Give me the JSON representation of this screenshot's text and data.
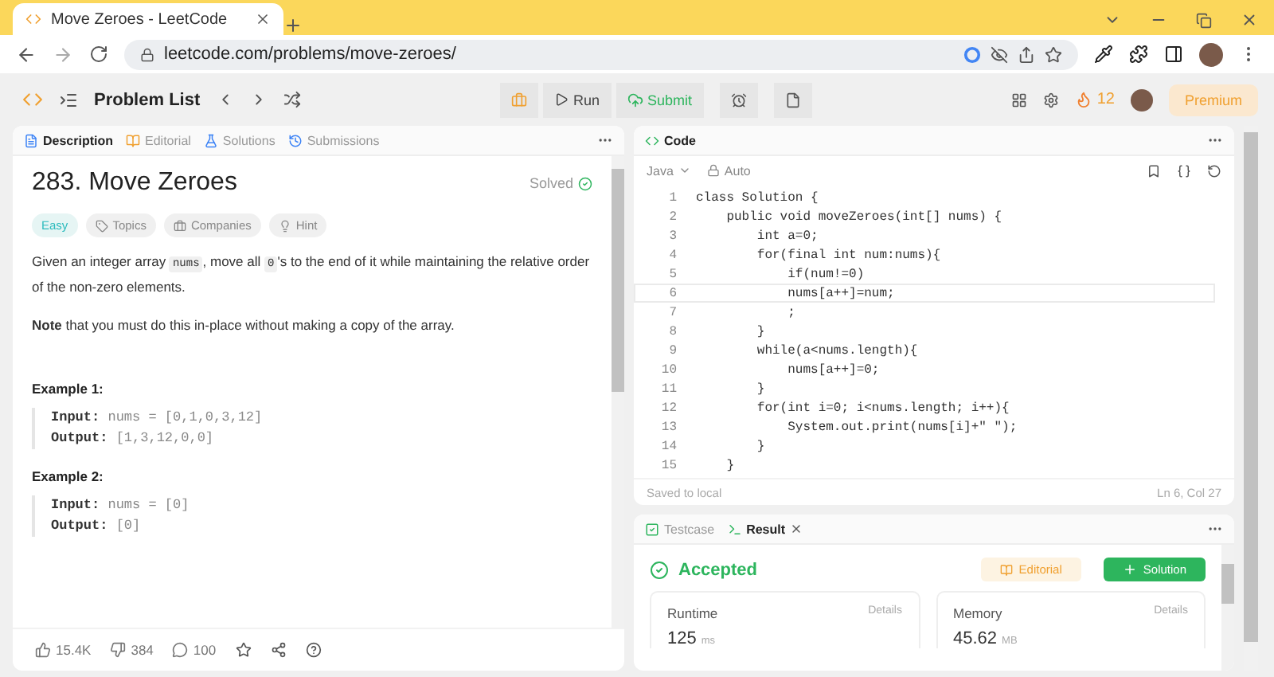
{
  "browser": {
    "tab_title": "Move Zeroes - LeetCode",
    "url": "leetcode.com/problems/move-zeroes/"
  },
  "header": {
    "nav_title": "Problem List",
    "run": "Run",
    "submit": "Submit",
    "streak": "12",
    "premium": "Premium"
  },
  "description_panel": {
    "tabs": [
      {
        "kind": "description",
        "label": "Description",
        "selected": true
      },
      {
        "kind": "editorial",
        "label": "Editorial",
        "selected": false
      },
      {
        "kind": "solutions",
        "label": "Solutions",
        "selected": false
      },
      {
        "kind": "submissions",
        "label": "Submissions",
        "selected": false
      }
    ],
    "title": "283. Move Zeroes",
    "status": "Solved",
    "tags": [
      {
        "kind": "difficulty",
        "label": "Easy"
      },
      {
        "kind": "topics",
        "label": "Topics"
      },
      {
        "kind": "companies",
        "label": "Companies"
      },
      {
        "kind": "hint",
        "label": "Hint"
      }
    ],
    "paragraph": [
      {
        "kind": "text",
        "text": "Given an integer array "
      },
      {
        "kind": "code",
        "text": "nums"
      },
      {
        "kind": "text",
        "text": ", move all "
      },
      {
        "kind": "code",
        "text": "0"
      },
      {
        "kind": "text",
        "text": "'s to the end of it while maintaining the relative order of the non-zero elements."
      }
    ],
    "note": "**Note** that you must do this in-place without making a copy of the array.",
    "examples": [
      {
        "title": "Example 1:",
        "input_label": "Input:",
        "input": "nums = [0,1,0,3,12]",
        "output_label": "Output:",
        "output": "[1,3,12,0,0]"
      },
      {
        "title": "Example 2:",
        "input_label": "Input:",
        "input": "nums = [0]",
        "output_label": "Output:",
        "output": "[0]"
      }
    ],
    "footer": {
      "likes": "15.4K",
      "dislikes": "384",
      "comments": "100"
    }
  },
  "code_panel": {
    "title": "Code",
    "language": "Java",
    "mode": "Auto",
    "lines": [
      {
        "number": "1",
        "text": "class Solution {",
        "selected": false
      },
      {
        "number": "2",
        "text": "    public void moveZeroes(int[] nums) {",
        "selected": false
      },
      {
        "number": "3",
        "text": "        int a=0;",
        "selected": false
      },
      {
        "number": "4",
        "text": "        for(final int num:nums){",
        "selected": false
      },
      {
        "number": "5",
        "text": "            if(num!=0)",
        "selected": false
      },
      {
        "number": "6",
        "text": "            nums[a++]=num;",
        "selected": true
      },
      {
        "number": "7",
        "text": "            ;",
        "selected": false
      },
      {
        "number": "8",
        "text": "        }",
        "selected": false
      },
      {
        "number": "9",
        "text": "        while(a<nums.length){",
        "selected": false
      },
      {
        "number": "10",
        "text": "            nums[a++]=0;",
        "selected": false
      },
      {
        "number": "11",
        "text": "        }",
        "selected": false
      },
      {
        "number": "12",
        "text": "        for(int i=0; i<nums.length; i++){",
        "selected": false
      },
      {
        "number": "13",
        "text": "            System.out.print(nums[i]+\" \");",
        "selected": false
      },
      {
        "number": "14",
        "text": "        }",
        "selected": false
      },
      {
        "number": "15",
        "text": "    }",
        "selected": false
      }
    ],
    "status_left": "Saved to local",
    "status_right": "Ln 6, Col 27"
  },
  "result_panel": {
    "tabs": [
      {
        "kind": "testcase",
        "label": "Testcase",
        "selected": false
      },
      {
        "kind": "result",
        "label": "Result",
        "selected": true
      }
    ],
    "verdict": "Accepted",
    "editorial": "Editorial",
    "solution": "Solution",
    "cards": [
      {
        "label": "Runtime",
        "details": "Details",
        "value": "125",
        "unit": "ms"
      },
      {
        "label": "Memory",
        "details": "Details",
        "value": "45.62",
        "unit": "MB"
      }
    ]
  }
}
